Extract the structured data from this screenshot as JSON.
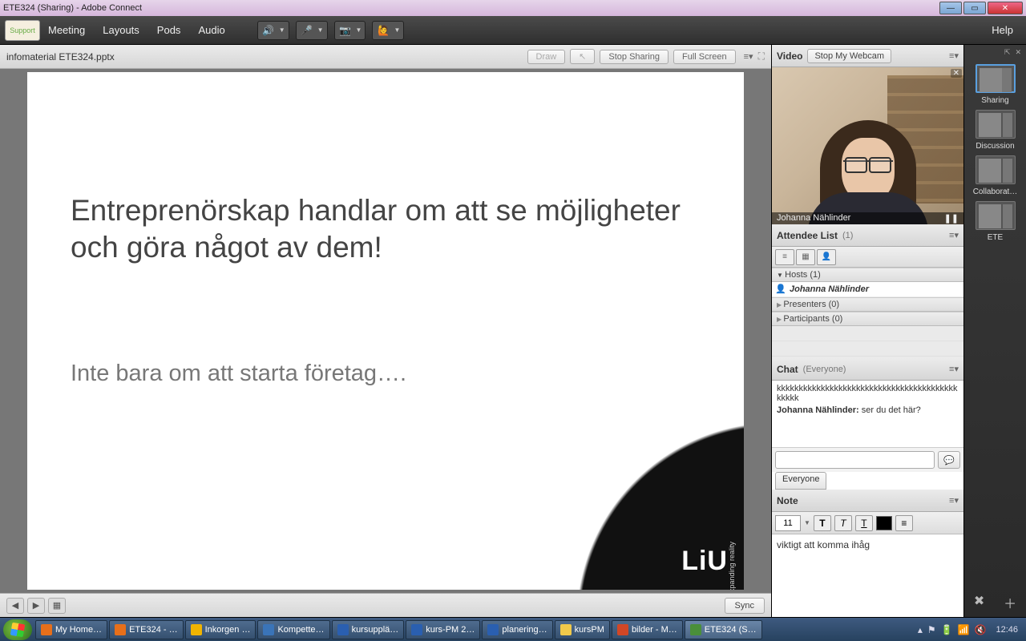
{
  "window": {
    "title": "ETE324 (Sharing) - Adobe Connect"
  },
  "menubar": {
    "support": "Support",
    "items": [
      "Meeting",
      "Layouts",
      "Pods",
      "Audio"
    ],
    "help": "Help"
  },
  "share_pod": {
    "filename": "infomaterial ETE324.pptx",
    "buttons": {
      "draw": "Draw",
      "pointer": "↖",
      "stop": "Stop Sharing",
      "full": "Full Screen"
    },
    "slide": {
      "heading": "Entreprenörskap handlar om att se möjligheter och göra något av dem!",
      "sub": "Inte bara om att starta företag….",
      "logo": "LiU",
      "logo_sub": "expanding reality"
    },
    "sync": "Sync"
  },
  "video_pod": {
    "label": "Video",
    "stop_btn": "Stop My Webcam",
    "presenter_name": "Johanna Nählinder",
    "pause_icon": "❚❚"
  },
  "attendee_pod": {
    "label": "Attendee List",
    "count": "(1)",
    "groups": {
      "hosts": "Hosts (1)",
      "presenters": "Presenters (0)",
      "participants": "Participants (0)"
    },
    "host_name": "Johanna Nählinder"
  },
  "chat_pod": {
    "label": "Chat",
    "scope": "(Everyone)",
    "lines": [
      {
        "who": "",
        "text": "kkkkkkkkkkkkkkkkkkkkkkkkkkkkkkkkkkkkkkkkkkkkkk"
      },
      {
        "who": "Johanna Nählinder:",
        "text": " ser du det här?"
      }
    ],
    "tab": "Everyone"
  },
  "note_pod": {
    "label": "Note",
    "font_size": "11",
    "text": "viktigt att komma ihåg"
  },
  "layouts": {
    "items": [
      {
        "label": "Sharing",
        "active": true
      },
      {
        "label": "Discussion",
        "active": false
      },
      {
        "label": "Collaborat…",
        "active": false
      },
      {
        "label": "ETE",
        "active": false
      }
    ]
  },
  "taskbar": {
    "items": [
      {
        "label": "My Home…",
        "color": "#e76f1a"
      },
      {
        "label": "ETE324 - …",
        "color": "#e76f1a"
      },
      {
        "label": "Inkorgen …",
        "color": "#f0b400"
      },
      {
        "label": "Kompette…",
        "color": "#3a74b8"
      },
      {
        "label": "kursupplä…",
        "color": "#2a5fb0"
      },
      {
        "label": "kurs-PM 2…",
        "color": "#2a5fb0"
      },
      {
        "label": "planering…",
        "color": "#2a5fb0"
      },
      {
        "label": "kursPM",
        "color": "#f0c94a"
      },
      {
        "label": "bilder - M…",
        "color": "#d24726"
      },
      {
        "label": "ETE324 (S…",
        "color": "#4a8f3a",
        "active": true
      }
    ],
    "clock": "12:46"
  }
}
